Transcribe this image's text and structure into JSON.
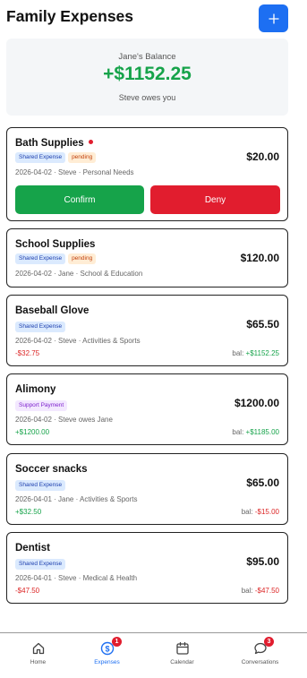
{
  "header": {
    "title": "Family Expenses"
  },
  "balance": {
    "label": "Jane's Balance",
    "amount": "+$1152.25",
    "subtitle": "Steve owes you"
  },
  "expenses": [
    {
      "name": "Bath Supplies",
      "badges": [
        "Shared Expense",
        "pending"
      ],
      "meta": "2026-04-02 · Steve · Personal Needs",
      "amount": "$20.00",
      "confirm": "Confirm",
      "deny": "Deny"
    },
    {
      "name": "School Supplies",
      "badges": [
        "Shared Expense",
        "pending"
      ],
      "meta": "2026-04-02 · Jane · School & Education",
      "amount": "$120.00"
    },
    {
      "name": "Baseball Glove",
      "badges": [
        "Shared Expense"
      ],
      "meta": "2026-04-02 · Steve · Activities & Sports",
      "amount": "$65.50",
      "share": "-$32.75",
      "bal_label": "bal:",
      "bal_value": "+$1152.25"
    },
    {
      "name": "Alimony",
      "badges": [
        "Support Payment"
      ],
      "meta": "2026-04-02 · Steve owes Jane",
      "amount": "$1200.00",
      "share": "+$1200.00",
      "bal_label": "bal:",
      "bal_value": "+$1185.00"
    },
    {
      "name": "Soccer snacks",
      "badges": [
        "Shared Expense"
      ],
      "meta": "2026-04-01 · Jane · Activities & Sports",
      "amount": "$65.00",
      "share": "+$32.50",
      "bal_label": "bal:",
      "bal_value": "-$15.00"
    },
    {
      "name": "Dentist",
      "badges": [
        "Shared Expense"
      ],
      "meta": "2026-04-01 · Steve · Medical & Health",
      "amount": "$95.00",
      "share": "-$47.50",
      "bal_label": "bal:",
      "bal_value": "-$47.50"
    }
  ],
  "nav": {
    "items": [
      {
        "label": "Home",
        "icon": "home-icon"
      },
      {
        "label": "Expenses",
        "icon": "dollar-icon",
        "badge": "1"
      },
      {
        "label": "Calendar",
        "icon": "calendar-icon"
      },
      {
        "label": "Conversations",
        "icon": "chat-icon",
        "badge": "3"
      }
    ]
  },
  "colors": {
    "accent": "#1d6ff2",
    "positive": "#16a34a",
    "negative": "#dc2626",
    "deny": "#e11d2e"
  }
}
